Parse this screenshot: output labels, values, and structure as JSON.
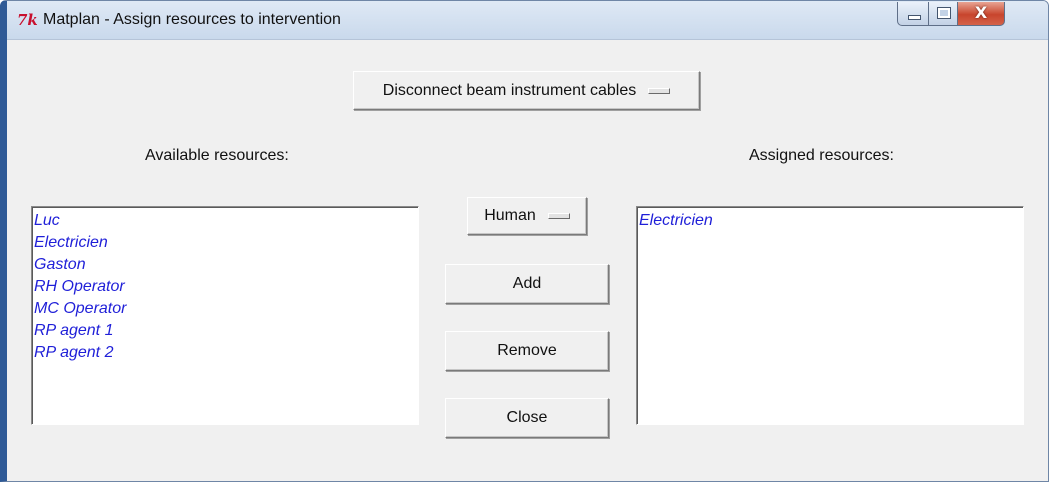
{
  "window": {
    "title": "Matplan - Assign resources to intervention",
    "app_icon_text": "7k",
    "controls": {
      "minimize_icon": "minimize-icon",
      "maximize_icon": "maximize-icon",
      "close_glyph": "X"
    }
  },
  "intervention_menu": {
    "selected": "Disconnect beam instrument cables"
  },
  "available": {
    "label": "Available resources:",
    "items": [
      "Luc",
      "Electricien",
      "Gaston",
      "RH Operator",
      "MC Operator",
      "RP agent 1",
      "RP agent 2"
    ]
  },
  "assigned": {
    "label": "Assigned resources:",
    "items": [
      "Electricien"
    ]
  },
  "type_menu": {
    "selected": "Human"
  },
  "buttons": {
    "add": "Add",
    "remove": "Remove",
    "close": "Close"
  },
  "colors": {
    "list_text": "#1f1fd8",
    "window_bg": "#f0f0f0",
    "title_icon": "#c8102e"
  }
}
